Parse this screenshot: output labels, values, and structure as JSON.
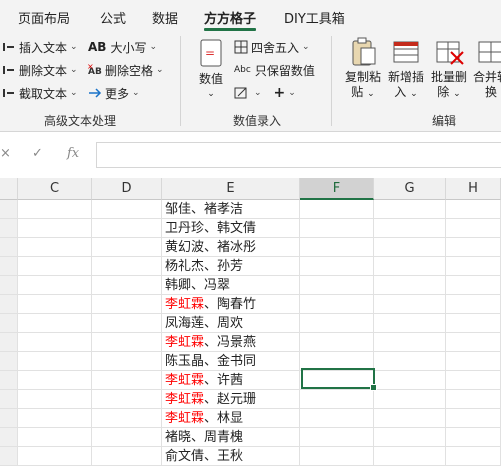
{
  "tabs": [
    "页面布局",
    "公式",
    "数据",
    "方方格子",
    "DIY工具箱"
  ],
  "active_tab": "方方格子",
  "ribbon": {
    "text_group": {
      "insert_text": "插入文本",
      "delete_text": "删除文本",
      "extract_text": "截取文本",
      "upper": "大小写",
      "remove_space": "删除空格",
      "more": "更多",
      "label": "高级文本处理"
    },
    "number_group": {
      "numeric": "数值",
      "round": "四舍五入",
      "keep_numbers": "只保留数值",
      "label": "数值录入"
    },
    "edit_group": {
      "copy_paste_1": "复制粘",
      "copy_paste_2": "贴",
      "insert_new_1": "新增插",
      "insert_new_2": "入",
      "batch_delete_1": "批量删",
      "batch_delete_2": "除",
      "merge_1": "合并转",
      "merge_2": "换",
      "label": "编辑"
    },
    "abc_label": "Abc",
    "ab_label": "AB"
  },
  "formula_bar": {
    "fx": "fx",
    "value": ""
  },
  "columns": [
    "C",
    "D",
    "E",
    "F",
    "G",
    "H"
  ],
  "selected_column": "F",
  "rows": [
    {
      "text": "邹佳、褚孝洁",
      "red": ""
    },
    {
      "text": "卫丹珍、韩文倩",
      "red": ""
    },
    {
      "text": "黄幻波、褚冰彤",
      "red": ""
    },
    {
      "text": "杨礼杰、孙芳",
      "red": ""
    },
    {
      "text": "韩卿、冯翠",
      "red": ""
    },
    {
      "text": "、陶春竹",
      "red": "李虹霖"
    },
    {
      "text": "凤海莲、周欢",
      "red": ""
    },
    {
      "text": "、冯景燕",
      "red": "李虹霖"
    },
    {
      "text": "陈玉晶、金书同",
      "red": ""
    },
    {
      "text": "、许茜",
      "red": "李虹霖"
    },
    {
      "text": "、赵元珊",
      "red": "李虹霖"
    },
    {
      "text": "、林显",
      "red": "李虹霖"
    },
    {
      "text": "褚晓、周青槐",
      "red": ""
    },
    {
      "text": "俞文倩、王秋",
      "red": ""
    }
  ],
  "colors": {
    "accent": "#217346",
    "highlight": "#ff0000"
  }
}
